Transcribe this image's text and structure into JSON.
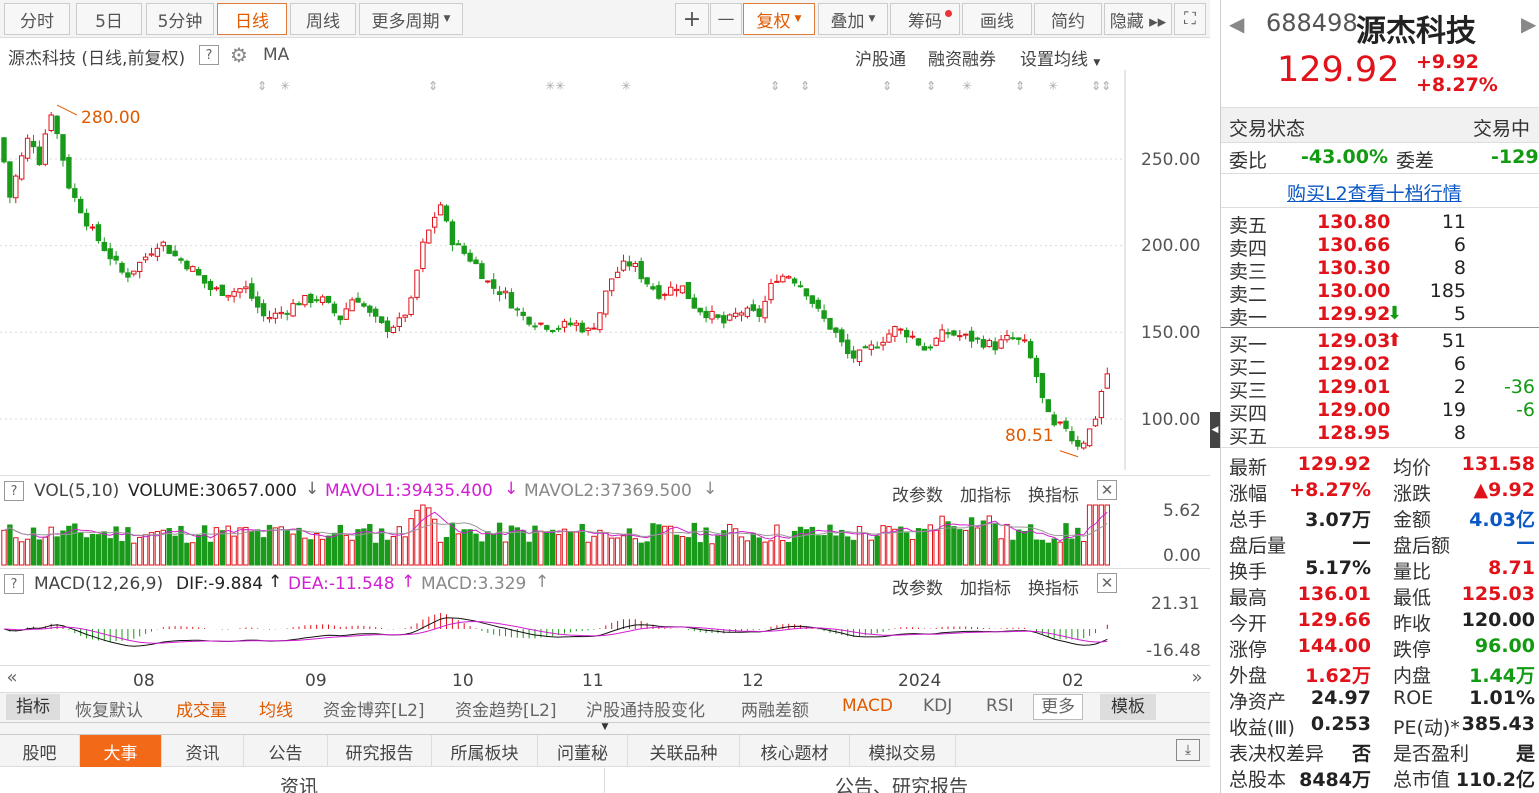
{
  "toolbar": {
    "tabs": [
      "分时",
      "5日",
      "5分钟",
      "日线",
      "周线",
      "更多周期"
    ],
    "plus": "+",
    "minus": "—",
    "fuquan": "复权",
    "overlay": "叠加",
    "chips": "筹码",
    "draw": "画线",
    "simple": "简约",
    "hide": "隐藏 ▸▸"
  },
  "chart_header": {
    "title": "源杰科技 (日线,前复权)",
    "indicator": "MA",
    "links": [
      "沪股通",
      "融资融券",
      "设置均线"
    ]
  },
  "price_axis": [
    "250.00",
    "200.00",
    "150.00",
    "100.00"
  ],
  "annotations": {
    "high": "280.00",
    "low": "80.51"
  },
  "vol_header": {
    "vol": "VOL(5,10)",
    "volume": "VOLUME:30657.000",
    "mavol1": "MAVOL1:39435.400",
    "mavol2": "MAVOL2:37369.500",
    "actions": [
      "改参数",
      "加指标",
      "换指标"
    ],
    "axis": [
      "5.62",
      "0.00"
    ]
  },
  "macd_header": {
    "macd": "MACD(12,26,9)",
    "dif": "DIF:-9.884",
    "dea": "DEA:-11.548",
    "val": "MACD:3.329",
    "actions": [
      "改参数",
      "加指标",
      "换指标"
    ],
    "axis": [
      "21.31",
      "-16.48"
    ]
  },
  "date_axis": [
    "08",
    "09",
    "10",
    "11",
    "12",
    "2024",
    "02"
  ],
  "indicator_tabs": [
    "指标",
    "恢复默认",
    "成交量",
    "均线",
    "资金博弈[L2]",
    "资金趋势[L2]",
    "沪股通持股变化",
    "两融差额",
    "MACD",
    "KDJ",
    "RSI",
    "更多",
    "模板"
  ],
  "bottom_tabs": [
    "股吧",
    "大事",
    "资讯",
    "公告",
    "研究报告",
    "所属板块",
    "问董秘",
    "关联品种",
    "核心题材",
    "模拟交易"
  ],
  "bottom_sub": [
    "资讯",
    "公告、研究报告"
  ],
  "stock": {
    "code": "688498",
    "name": "源杰科技",
    "price": "129.92",
    "change": "+9.92",
    "pct": "+8.27%",
    "status_label": "交易状态",
    "status": "交易中",
    "weibi_label": "委比",
    "weibi": "-43.00%",
    "weicha_label": "委差",
    "weicha": "-129",
    "l2_link": "购买L2查看十档行情"
  },
  "order_book": {
    "asks": [
      {
        "label": "卖五",
        "price": "130.80",
        "vol": "11"
      },
      {
        "label": "卖四",
        "price": "130.66",
        "vol": "6"
      },
      {
        "label": "卖三",
        "price": "130.30",
        "vol": "8"
      },
      {
        "label": "卖二",
        "price": "130.00",
        "vol": "185"
      },
      {
        "label": "卖一",
        "price": "129.92",
        "vol": "5",
        "arrow": "⬇"
      }
    ],
    "bids": [
      {
        "label": "买一",
        "price": "129.03",
        "vol": "51",
        "arrow": "⬆"
      },
      {
        "label": "买二",
        "price": "129.02",
        "vol": "6"
      },
      {
        "label": "买三",
        "price": "129.01",
        "vol": "2",
        "chg": "-36"
      },
      {
        "label": "买四",
        "price": "129.00",
        "vol": "19",
        "chg": "-6"
      },
      {
        "label": "买五",
        "price": "128.95",
        "vol": "8"
      }
    ]
  },
  "stats": [
    [
      "最新",
      "129.92",
      "均价",
      "131.58"
    ],
    [
      "涨幅",
      "+8.27%",
      "涨跌",
      "▲9.92"
    ],
    [
      "总手",
      "3.07万",
      "金额",
      "4.03亿"
    ],
    [
      "盘后量",
      "—",
      "盘后额",
      "—"
    ],
    [
      "换手",
      "5.17%",
      "量比",
      "8.71"
    ],
    [
      "最高",
      "136.01",
      "最低",
      "125.03"
    ],
    [
      "今开",
      "129.66",
      "昨收",
      "120.00"
    ],
    [
      "涨停",
      "144.00",
      "跌停",
      "96.00"
    ],
    [
      "外盘",
      "1.62万",
      "内盘",
      "1.44万"
    ],
    [
      "净资产",
      "24.97",
      "ROE",
      "1.01%"
    ],
    [
      "收益(Ⅲ)",
      "0.253",
      "PE(动)*",
      "385.43"
    ],
    [
      "表决权差异",
      "否",
      "是否盈利",
      "是"
    ],
    [
      "总股本",
      "8484万",
      "总市值",
      "110.2亿"
    ]
  ],
  "colors": {
    "up": "#e1131a",
    "down": "#1a9a1a",
    "accent": "#e05a00",
    "ma": "#999999",
    "mavol1": "#d21fd2",
    "link": "#0b57c4"
  }
}
